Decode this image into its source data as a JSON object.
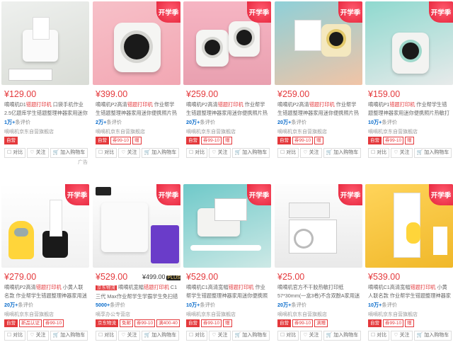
{
  "colors": {
    "price": "#e4393c",
    "badge": "#e4233a",
    "link": "#0a6ccb"
  },
  "badge_text": "开学季",
  "actions": {
    "compare": "对比",
    "follow": "关注",
    "cart": "加入购物车"
  },
  "ad_label": "广告",
  "row1": [
    {
      "price": "¥129.00",
      "title_pre": "嘀嘀机D1",
      "title_hl": "错题打印机",
      "title_post": " 口袋手机作业2.5亿题库学生错题整理神器家用迷你便携手账",
      "reviews_n": "1万+",
      "reviews_suffix": "条评价",
      "shop": "嘀嘀机京东自营旗舰店",
      "tags": [
        "自营"
      ],
      "badge": false
    },
    {
      "price": "¥399.00",
      "title_pre": "嘀嘀机P2高清",
      "title_hl": "错题打印机",
      "title_post": " 作业帮学生错题整理神器家用迷你便携照片热敏打印机",
      "reviews_n": "2万+",
      "reviews_suffix": "条评价",
      "shop": "嘀嘀机京东自营旗舰店",
      "tags": [
        "自营",
        "券99-10",
        "赠"
      ],
      "badge": true
    },
    {
      "price": "¥259.00",
      "title_pre": "嘀嘀机P2高清",
      "title_hl": "错题打印机",
      "title_post": " 作业帮学生错题整理神器家用迷你便携照片热敏打印机",
      "reviews_n": "20万+",
      "reviews_suffix": "条评价",
      "shop": "嘀嘀机京东自营旗舰店",
      "tags": [
        "自营",
        "券99-10",
        "赠"
      ],
      "badge": true
    },
    {
      "price": "¥259.00",
      "title_pre": "嘀嘀机P2高清",
      "title_hl": "错题打印机",
      "title_post": " 作业帮学生错题整理神器家用迷你便携照片热敏打印机",
      "reviews_n": "20万+",
      "reviews_suffix": "条评价",
      "shop": "嘀嘀机京东自营旗舰店",
      "tags": [
        "自营",
        "券99-10",
        "赠"
      ],
      "badge": true
    },
    {
      "price": "¥159.00",
      "title_pre": "嘀嘀机P1",
      "title_hl": "错题打印机",
      "title_post": " 作业帮学生错题整理神器家用迷你便携照片热敏打印机 白",
      "reviews_n": "10万+",
      "reviews_suffix": "条评价",
      "shop": "嘀嘀机京东自营旗舰店",
      "tags": [
        "自营",
        "券99-10",
        "赠"
      ],
      "badge": true
    }
  ],
  "row2": [
    {
      "price": "¥279.00",
      "title_pre": "嘀嘀机P2高清",
      "title_hl": "错题打印机",
      "title_post": " 小黄人联名款 作业帮学生错题整理神器家用迷你便携",
      "reviews_n": "20万+",
      "reviews_suffix": "条评价",
      "shop": "嘀嘀机京东自营旗舰店",
      "tags": [
        "自营",
        "新品认证",
        "券99-10"
      ],
      "badge": true
    },
    {
      "price": "¥529.00",
      "price2": "¥499.00",
      "price2_tag": "PLUS",
      "title_pre": "嘀嘀机宽幅",
      "title_hl": "错题打印机",
      "title_post": " C1三代 Max作业帮学生学霸学生免扫错题整理神器",
      "reviews_n": "5000+",
      "reviews_suffix": "条评价",
      "shop": "嘀享办公专营店",
      "tags": [
        "京东物流",
        "免邮",
        "券99-10",
        "满400-40"
      ],
      "badge": true,
      "brand_tag": "京东物流"
    },
    {
      "price": "¥529.00",
      "title_pre": "嘀嘀机C1高清宽幅",
      "title_hl": "错题打印机",
      "title_post": " 作业帮学生错题整理神器家用迷你便携照片热敏打印",
      "reviews_n": "10万+",
      "reviews_suffix": "条评价",
      "shop": "嘀嘀机京东自营旗舰店",
      "tags": [
        "自营",
        "券99-10",
        "赠"
      ],
      "badge": true
    },
    {
      "price": "¥25.00",
      "title_pre": "嘀嘀机官方不干胶热敏打印纸 57*30mm(一盒3卷)不含双酚A家用迷你便",
      "title_hl": "",
      "title_post": "",
      "reviews_n": "20万+",
      "reviews_suffix": "条评价",
      "shop": "嘀嘀机京东自营旗舰店",
      "tags": [
        "自营",
        "券99-10",
        "满赠"
      ],
      "badge": true
    },
    {
      "price": "¥539.00",
      "title_pre": "嘀嘀机C1高清宽幅",
      "title_hl": "错题打印机",
      "title_post": " 小黄人联名款 作业帮学生错题整理神器家用迷你便携",
      "reviews_n": "10万+",
      "reviews_suffix": "条评价",
      "shop": "嘀嘀机京东自营旗舰店",
      "tags": [
        "自营",
        "券99-10",
        "赠"
      ],
      "badge": true
    }
  ]
}
